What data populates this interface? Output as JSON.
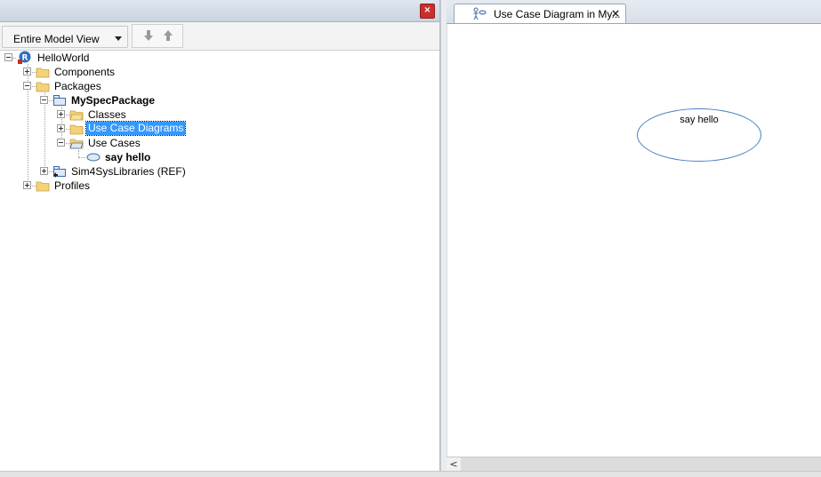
{
  "left_panel": {
    "close_glyph": "×",
    "view_select": {
      "value": "Entire Model View"
    }
  },
  "tree": {
    "items": [
      {
        "id": "helloworld",
        "label": "HelloWorld",
        "icon": "project-logo-icon"
      },
      {
        "id": "components",
        "label": "Components",
        "icon": "folder-icon"
      },
      {
        "id": "packages",
        "label": "Packages",
        "icon": "folder-open-icon"
      },
      {
        "id": "myspecpackage",
        "label": "MySpecPackage",
        "icon": "package-icon"
      },
      {
        "id": "classes",
        "label": "Classes",
        "icon": "folder-open-icon"
      },
      {
        "id": "usecasediagrams",
        "label": "Use Case Diagrams",
        "icon": "folder-icon"
      },
      {
        "id": "usecases",
        "label": "Use Cases",
        "icon": "folder-open-icon"
      },
      {
        "id": "sayhello",
        "label": "say hello",
        "icon": "use-case-icon"
      },
      {
        "id": "sim4sys",
        "label": "Sim4SysLibraries (REF)",
        "icon": "package-ref-icon"
      },
      {
        "id": "profiles",
        "label": "Profiles",
        "icon": "folder-icon"
      }
    ]
  },
  "editor": {
    "tab_label": "Use Case Diagram in My...",
    "tab_close_glyph": "×",
    "scroll_left_glyph": "<",
    "use_case": {
      "label": "say hello"
    }
  },
  "colors": {
    "selection": "#3399ff",
    "use_case_border": "#4a7fbf",
    "close_button": "#c9302c"
  }
}
